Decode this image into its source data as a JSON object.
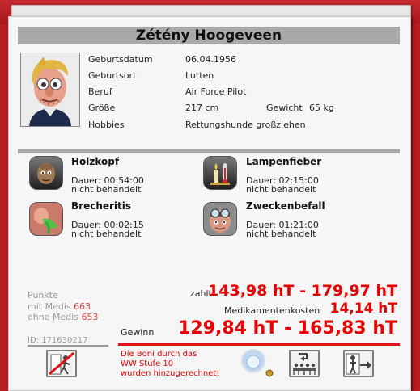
{
  "patient": {
    "name": "Zétény Hoogeveen",
    "fields": [
      {
        "label": "Geburtsdatum",
        "value": "06.04.1956"
      },
      {
        "label": "Geburtsort",
        "value": "Lutten"
      },
      {
        "label": "Beruf",
        "value": "Air Force Pilot"
      },
      {
        "label": "Größe",
        "value": "217 cm"
      },
      {
        "label": "Hobbies",
        "value": "Rettungshunde großziehen"
      }
    ],
    "weight_label": "Gewicht",
    "weight_value": "65 kg"
  },
  "illnesses": [
    {
      "name": "Holzkopf",
      "duration": "Dauer: 00:54:00",
      "status": "nicht behandelt",
      "icon": "wooden-head-icon"
    },
    {
      "name": "Lampenfieber",
      "duration": "Dauer: 02:15:00",
      "status": "nicht behandelt",
      "icon": "candle-thermometer-icon"
    },
    {
      "name": "Brecheritis",
      "duration": "Dauer: 00:02:15",
      "status": "nicht behandelt",
      "icon": "vomit-icon"
    },
    {
      "name": "Zweckenbefall",
      "duration": "Dauer: 01:21:00",
      "status": "nicht behandelt",
      "icon": "pins-head-icon"
    }
  ],
  "points": {
    "title": "Punkte",
    "with_label": "mit Medis",
    "with_value": "663",
    "without_label": "ohne Medis",
    "without_value": "653"
  },
  "patient_id": "ID: 171630217",
  "payment": {
    "pays_label": "zahlt",
    "pays_value": "143,98 hT - 179,97 hT",
    "medcost_label": "Medikamentenkosten",
    "medcost_value": "14,14 hT",
    "profit_label": "Gewinn",
    "profit_value": "129,84 hT - 165,83 hT"
  },
  "bonus_lines": [
    "Die Boni durch das",
    "WW Stufe 10",
    "wurden hinzugerechnet!"
  ],
  "actions": [
    "discharge-patient-icon",
    "glowing-orb-icon",
    "waiting-room-icon",
    "send-to-room-icon"
  ],
  "colors": {
    "accent_red": "#e60000",
    "background_red": "#b81d22",
    "points_red": "#d94848"
  }
}
